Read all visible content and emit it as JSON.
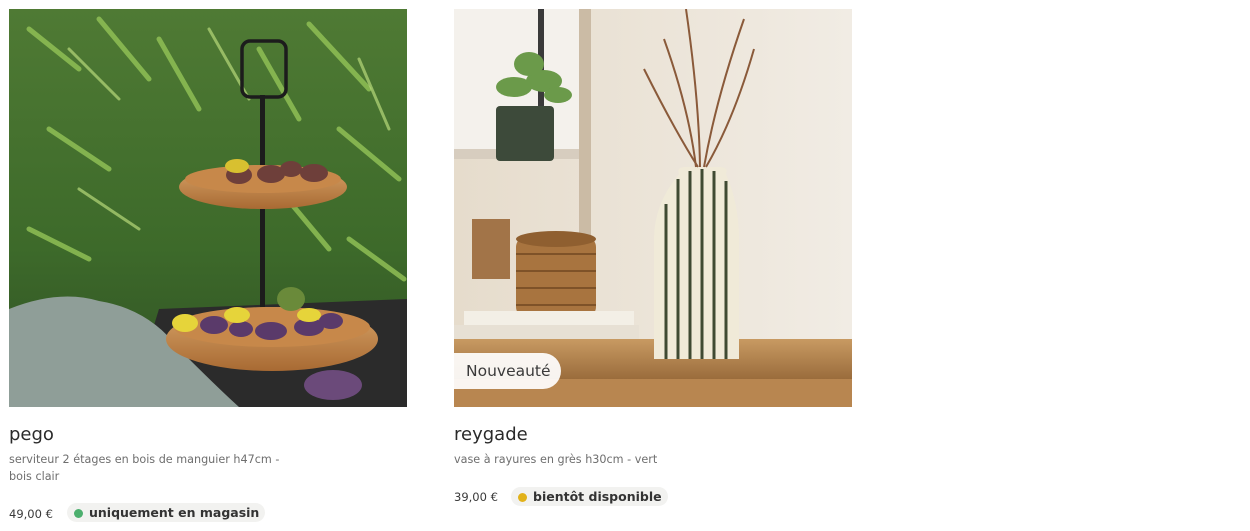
{
  "products": [
    {
      "name": "pego",
      "description": "serviteur 2 étages en bois de manguier h47cm - bois clair",
      "price": "49,00 €",
      "availability": {
        "label": "uniquement en magasin",
        "color": "#4caf6e"
      },
      "badge": ""
    },
    {
      "name": "reygade",
      "description": "vase à rayures en grès h30cm - vert",
      "price": "39,00 €",
      "availability": {
        "label": "bientôt disponible",
        "color": "#e2b21a"
      },
      "badge": "Nouveauté"
    }
  ],
  "icons": {
    "status_dot": "status-dot-icon"
  }
}
